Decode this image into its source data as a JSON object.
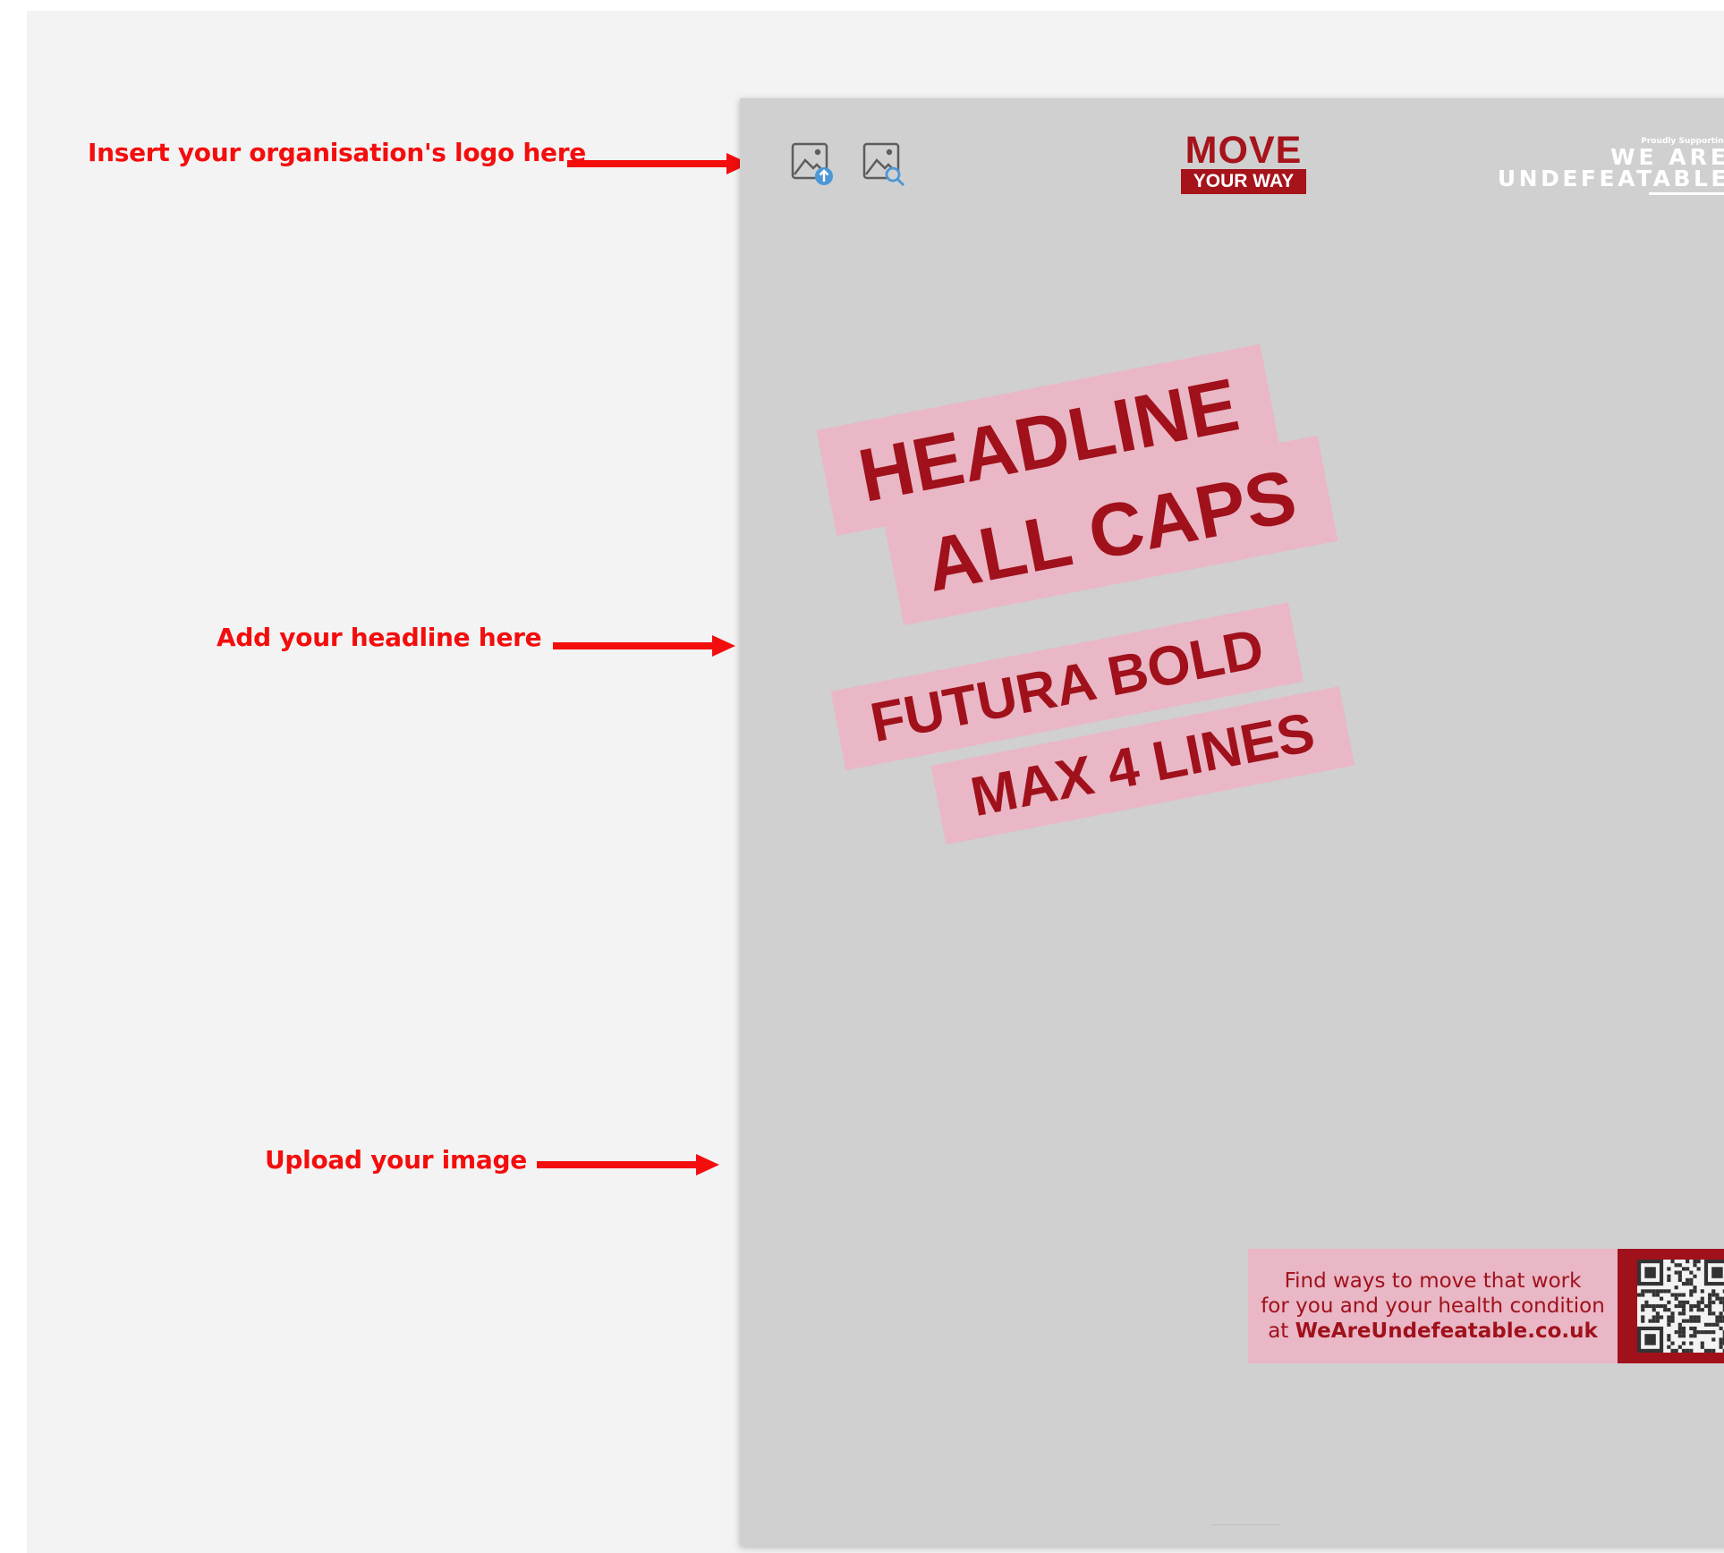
{
  "annotations": {
    "logo": "Insert your organisation's logo here",
    "headline": "Add your headline here",
    "image": "Upload your image"
  },
  "poster": {
    "brand": {
      "top": "MOVE",
      "bottom": "YOUR WAY"
    },
    "supporter": {
      "small": "Proudly Supporting",
      "line1": "WE ARE",
      "line2": "UNDEFEATABLE"
    },
    "headline_lines": [
      "HEADLINE",
      "ALL CAPS",
      "FUTURA BOLD",
      "MAX 4 LINES"
    ],
    "cta": {
      "line1": "Find ways to move that work",
      "line2": "for you and your health condition",
      "line3_prefix": "at ",
      "url": "WeAreUndefeatable.co.uk"
    }
  },
  "icons": [
    "image-upload-icon",
    "image-search-icon",
    "arrow-right-icon",
    "qr-code"
  ],
  "colors": {
    "annotation_red": "#f40d0d",
    "brand_red": "#a6131b",
    "headline_red": "#a0111b",
    "headline_band_pink": "#e9b7c6",
    "poster_gray": "#d0d0d0",
    "canvas_bg": "#f3f3f3"
  }
}
